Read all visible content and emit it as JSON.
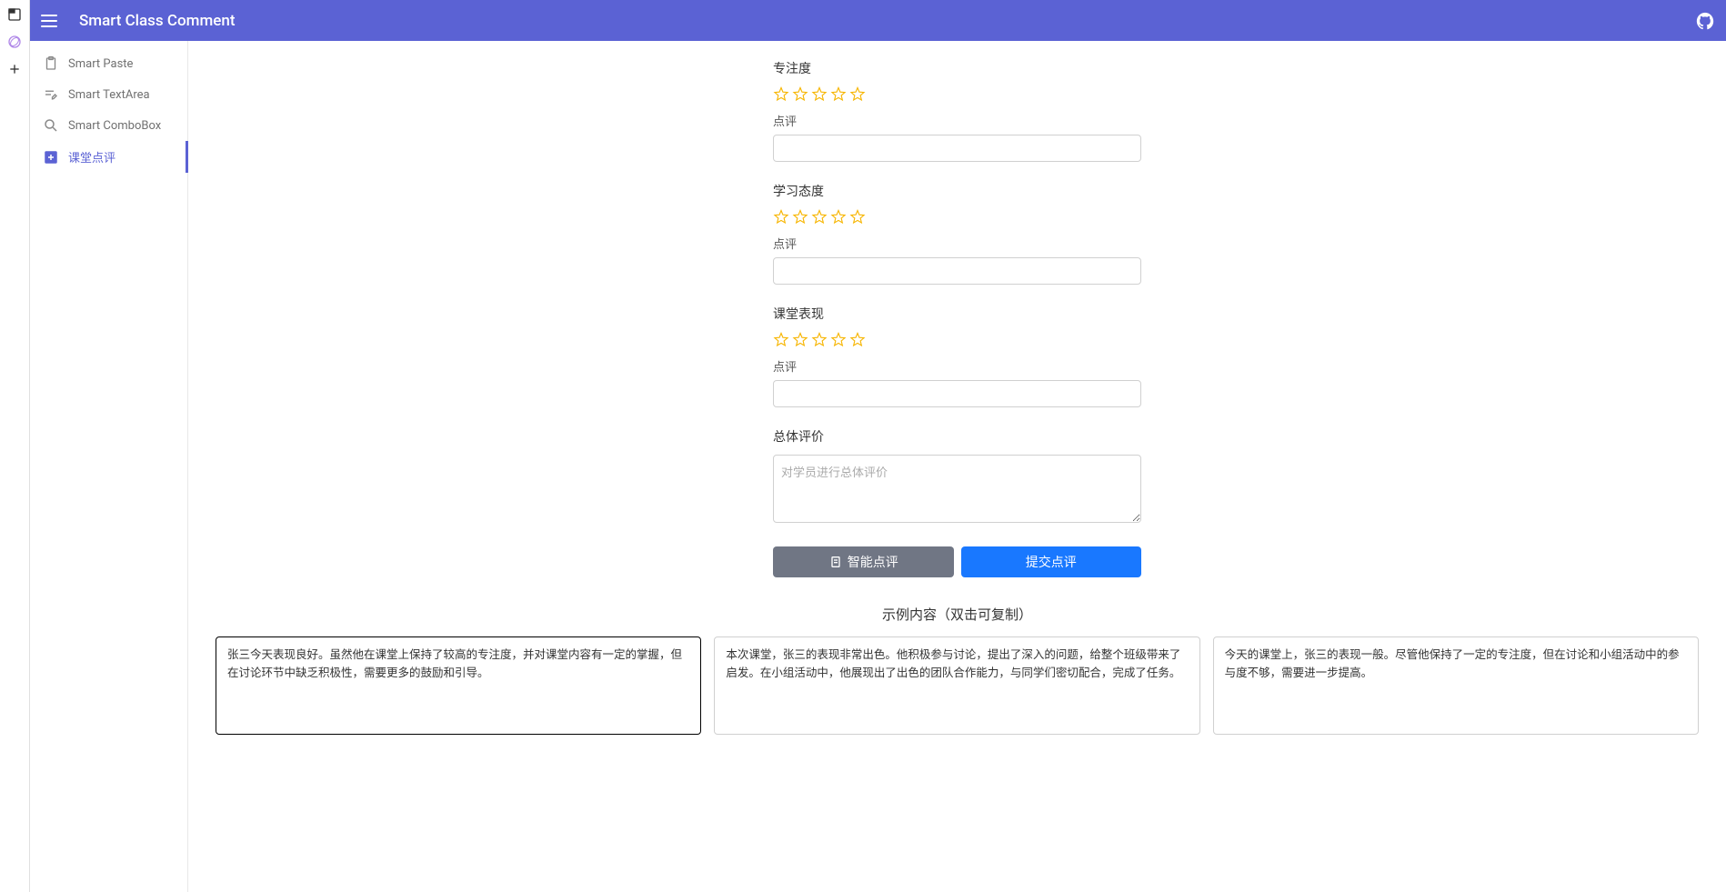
{
  "header": {
    "title": "Smart Class Comment"
  },
  "sidebar": {
    "items": [
      {
        "label": "Smart Paste"
      },
      {
        "label": "Smart TextArea"
      },
      {
        "label": "Smart ComboBox"
      },
      {
        "label": "课堂点评",
        "active": true
      }
    ]
  },
  "form": {
    "sections": [
      {
        "title": "专注度",
        "comment_label": "点评"
      },
      {
        "title": "学习态度",
        "comment_label": "点评"
      },
      {
        "title": "课堂表现",
        "comment_label": "点评"
      }
    ],
    "overall": {
      "title": "总体评价",
      "placeholder": "对学员进行总体评价"
    },
    "smart_btn": "智能点评",
    "submit_btn": "提交点评"
  },
  "examples": {
    "title": "示例内容（双击可复制）",
    "cards": [
      "张三今天表现良好。虽然他在课堂上保持了较高的专注度，并对课堂内容有一定的掌握，但在讨论环节中缺乏积极性，需要更多的鼓励和引导。",
      "本次课堂，张三的表现非常出色。他积极参与讨论，提出了深入的问题，给整个班级带来了启发。在小组活动中，他展现出了出色的团队合作能力，与同学们密切配合，完成了任务。",
      "今天的课堂上，张三的表现一般。尽管他保持了一定的专注度，但在讨论和小组活动中的参与度不够，需要进一步提高。"
    ]
  }
}
